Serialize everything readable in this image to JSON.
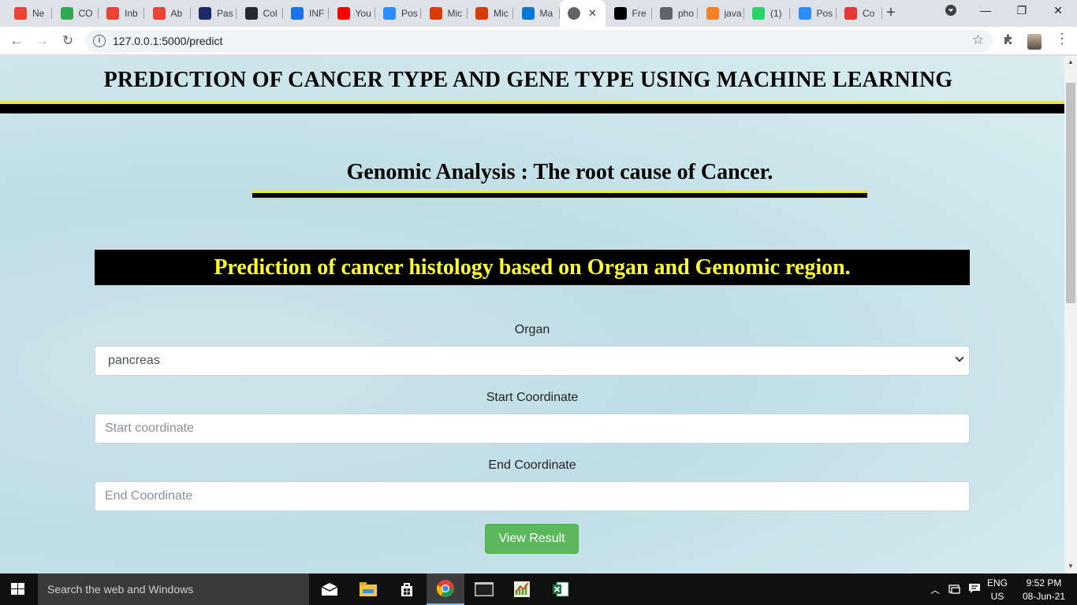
{
  "browser": {
    "tabs": [
      {
        "label": "Ne",
        "icon": "gmail-icon",
        "color": "#ea4335"
      },
      {
        "label": "CO",
        "icon": "drive-icon",
        "color": "#34a853"
      },
      {
        "label": "Inb",
        "icon": "gmail-icon",
        "color": "#ea4335"
      },
      {
        "label": "Ab",
        "icon": "gmail-icon",
        "color": "#ea4335"
      },
      {
        "label": "Pas",
        "icon": "page-icon",
        "color": "#1c2a6b"
      },
      {
        "label": "Col",
        "icon": "github-icon",
        "color": "#24292e"
      },
      {
        "label": "INF",
        "icon": "contacts-icon",
        "color": "#1a73e8"
      },
      {
        "label": "You",
        "icon": "youtube-icon",
        "color": "#ff0000"
      },
      {
        "label": "Pos",
        "icon": "zoom-icon",
        "color": "#2d8cff"
      },
      {
        "label": "Mic",
        "icon": "office-icon",
        "color": "#d83b01"
      },
      {
        "label": "Mic",
        "icon": "office-icon",
        "color": "#d83b01"
      },
      {
        "label": "Ma",
        "icon": "outlook-icon",
        "color": "#0078d4"
      },
      {
        "label": "",
        "icon": "globe-icon",
        "color": "#5f6368",
        "active": true
      },
      {
        "label": "Fre",
        "icon": "site-icon",
        "color": "#000000"
      },
      {
        "label": "pho",
        "icon": "globe-icon",
        "color": "#5f6368"
      },
      {
        "label": "java",
        "icon": "stackoverflow-icon",
        "color": "#f48024"
      },
      {
        "label": "(1)",
        "icon": "whatsapp-icon",
        "color": "#25d366"
      },
      {
        "label": "Pos",
        "icon": "zoom-icon",
        "color": "#2d8cff"
      },
      {
        "label": "Co",
        "icon": "site-icon",
        "color": "#e53935"
      }
    ],
    "url": "127.0.0.1:5000/predict"
  },
  "page": {
    "header_title": "PREDICTION OF CANCER TYPE AND GENE TYPE USING MACHINE LEARNING",
    "subtitle": "Genomic Analysis : The root cause of Cancer.",
    "banner": "Prediction of cancer histology based on Organ and Genomic region.",
    "form": {
      "organ_label": "Organ",
      "organ_value": "pancreas",
      "start_label": "Start Coordinate",
      "start_placeholder": "Start coordinate",
      "end_label": "End Coordinate",
      "end_placeholder": "End Coordinate",
      "submit_label": "View Result"
    },
    "colors": {
      "accent_yellow": "#f5f000",
      "banner_text": "#ffff33",
      "button_green": "#5cb85c"
    }
  },
  "taskbar": {
    "search_placeholder": "Search the web and Windows",
    "language": "ENG",
    "region": "US",
    "time": "9:52 PM",
    "date": "08-Jun-21"
  }
}
